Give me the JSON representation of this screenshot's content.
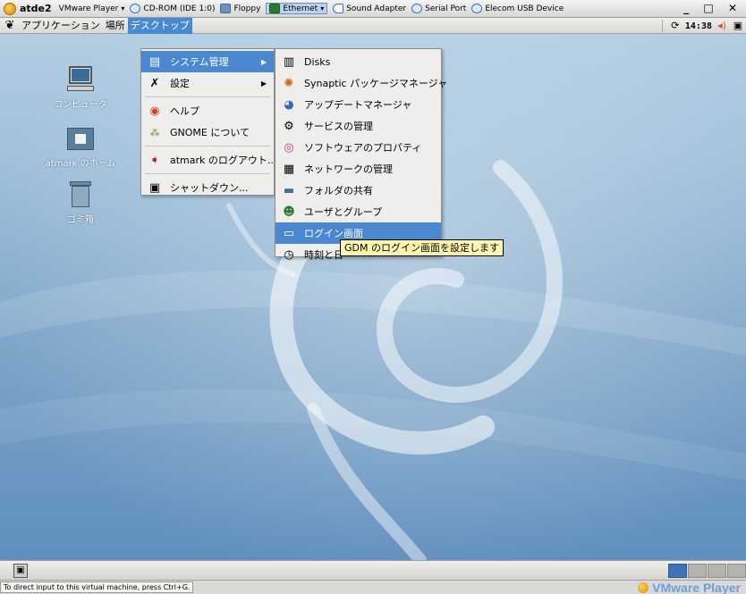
{
  "vmware_bar": {
    "title": "atde2",
    "player_menu": "VMware Player",
    "devices": [
      {
        "label": "CD-ROM (IDE 1:0)",
        "icon": "cdrom-icon"
      },
      {
        "label": "Floppy",
        "icon": "floppy-icon"
      },
      {
        "label": "Ethernet",
        "icon": "ethernet-icon"
      },
      {
        "label": "Sound Adapter",
        "icon": "sound-icon"
      },
      {
        "label": "Serial Port",
        "icon": "serial-port-icon"
      },
      {
        "label": "Elecom USB Device",
        "icon": "usb-device-icon"
      }
    ],
    "window_controls": "_ □ ✕"
  },
  "top_panel": {
    "menus": [
      "アプリケーション",
      "場所",
      "デスクトップ"
    ],
    "active_menu": "デスクトップ",
    "clock": "14:38"
  },
  "desktop_icons": [
    {
      "label": "コンピュータ",
      "icon": "computer-icon"
    },
    {
      "label": "atmark のホーム",
      "icon": "home-folder-icon"
    },
    {
      "label": "ゴミ箱",
      "icon": "trash-icon"
    }
  ],
  "desktop_menu": {
    "items": [
      {
        "label": "システム管理",
        "icon": "system-admin-icon",
        "submenu": true,
        "highlighted": true
      },
      {
        "label": "設定",
        "icon": "preferences-icon",
        "submenu": true
      },
      {
        "label": "ヘルプ",
        "icon": "help-icon"
      },
      {
        "label": "GNOME について",
        "icon": "gnome-icon"
      },
      {
        "label": "atmark のログアウト...",
        "icon": "logout-icon"
      },
      {
        "label": "シャットダウン...",
        "icon": "shutdown-icon"
      }
    ]
  },
  "admin_submenu": {
    "items": [
      {
        "label": "Disks",
        "icon": "disks-icon"
      },
      {
        "label": "Synaptic パッケージマネージャ",
        "icon": "synaptic-icon"
      },
      {
        "label": "アップデートマネージャ",
        "icon": "update-manager-icon"
      },
      {
        "label": "サービスの管理",
        "icon": "services-icon"
      },
      {
        "label": "ソフトウェアのプロパティ",
        "icon": "software-properties-icon"
      },
      {
        "label": "ネットワークの管理",
        "icon": "network-icon"
      },
      {
        "label": "フォルダの共有",
        "icon": "shared-folder-icon"
      },
      {
        "label": "ユーザとグループ",
        "icon": "users-groups-icon"
      },
      {
        "label": "ログイン画面",
        "icon": "login-screen-icon",
        "highlighted": true
      },
      {
        "label": "時刻と日",
        "icon": "time-date-icon"
      }
    ]
  },
  "tooltip": "GDM のログイン画面を設定します",
  "applet": {
    "glyphs": [
      "ⓦ",
      "=",
      "Ⓡ",
      "✕"
    ]
  },
  "status_bar": {
    "hint": "To direct input to this virtual machine, press Ctrl+G.",
    "brand": "VMware Player"
  },
  "colors": {
    "highlight": "#4a88d2",
    "desktop_blue": "#7ea6c9",
    "tooltip": "#fff7b0"
  }
}
